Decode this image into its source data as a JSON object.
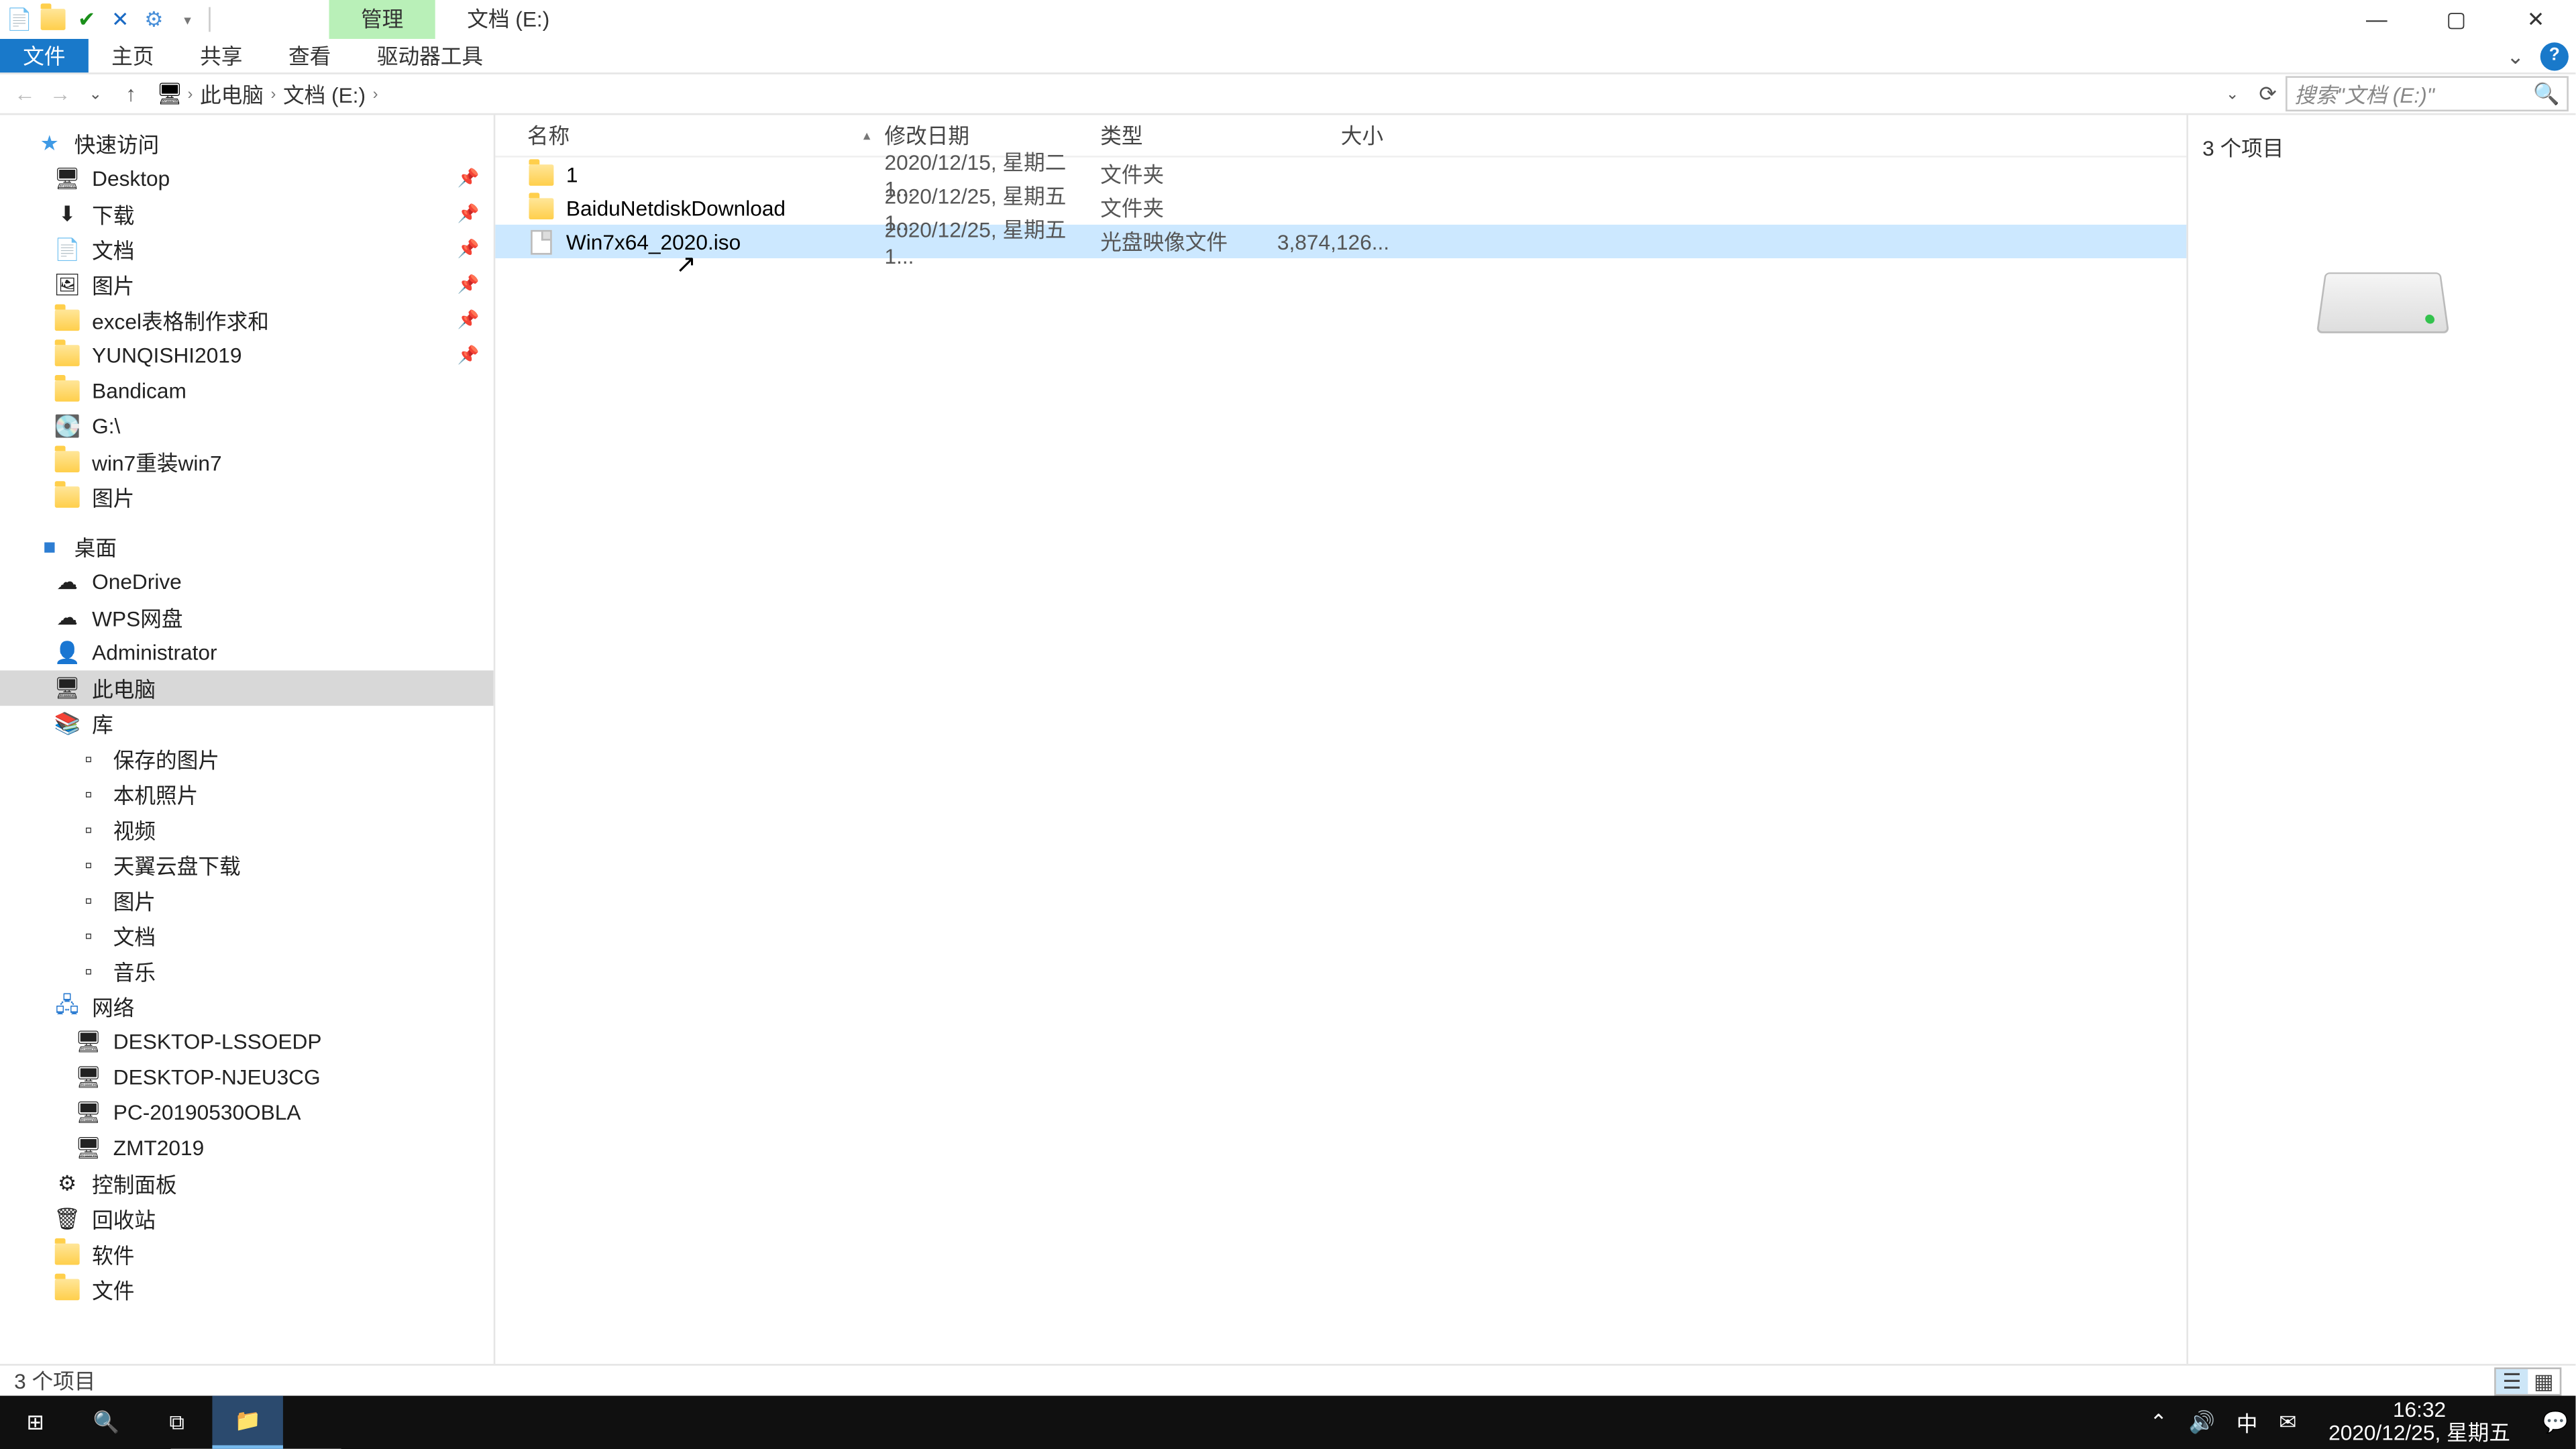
{
  "qat_icons": [
    "props-icon",
    "new-folder-icon",
    "checkbox-icon",
    "delete-x-icon",
    "gear-icon",
    "dropdown-icon"
  ],
  "title_context_tab": "管理",
  "title_location": "文档 (E:)",
  "win": {
    "min": "—",
    "max": "▢",
    "close": "✕"
  },
  "ribbon": {
    "file": "文件",
    "tabs": [
      "主页",
      "共享",
      "查看",
      "驱动器工具"
    ]
  },
  "help": {
    "expand": "⌄",
    "help": "?"
  },
  "nav_back": "←",
  "nav_fwd": "→",
  "nav_recent": "⌄",
  "nav_up": "↑",
  "crumbs": [
    "此电脑",
    "文档 (E:)"
  ],
  "addr_dd": "⌄",
  "addr_refresh": "⟳",
  "search_placeholder": "搜索\"文档 (E:)\"",
  "search_icon": "🔍",
  "sidebar_quick": "快速访问",
  "sidebar_quick_items": [
    {
      "icon": "desktop",
      "label": "Desktop",
      "pin": true
    },
    {
      "icon": "downloads",
      "label": "下载",
      "pin": true
    },
    {
      "icon": "docs",
      "label": "文档",
      "pin": true
    },
    {
      "icon": "pics",
      "label": "图片",
      "pin": true
    },
    {
      "icon": "folder",
      "label": "excel表格制作求和",
      "pin": true
    },
    {
      "icon": "folder",
      "label": "YUNQISHI2019",
      "pin": true
    },
    {
      "icon": "folder",
      "label": "Bandicam",
      "pin": false
    },
    {
      "icon": "drive",
      "label": "G:\\",
      "pin": false
    },
    {
      "icon": "folder",
      "label": "win7重装win7",
      "pin": false
    },
    {
      "icon": "folder",
      "label": "图片",
      "pin": false
    }
  ],
  "sidebar_desktop": "桌面",
  "sidebar_desktop_items": [
    {
      "icon": "onedrive",
      "label": "OneDrive"
    },
    {
      "icon": "wps",
      "label": "WPS网盘"
    },
    {
      "icon": "user",
      "label": "Administrator"
    },
    {
      "icon": "pc",
      "label": "此电脑",
      "sel": true
    },
    {
      "icon": "lib",
      "label": "库"
    }
  ],
  "sidebar_lib_items": [
    {
      "label": "保存的图片"
    },
    {
      "label": "本机照片"
    },
    {
      "label": "视频"
    },
    {
      "label": "天翼云盘下载"
    },
    {
      "label": "图片"
    },
    {
      "label": "文档"
    },
    {
      "label": "音乐"
    }
  ],
  "sidebar_network": "网络",
  "sidebar_net_items": [
    {
      "label": "DESKTOP-LSSOEDP"
    },
    {
      "label": "DESKTOP-NJEU3CG"
    },
    {
      "label": "PC-20190530OBLA"
    },
    {
      "label": "ZMT2019"
    }
  ],
  "sidebar_tail": [
    {
      "icon": "cpanel",
      "label": "控制面板"
    },
    {
      "icon": "recycle",
      "label": "回收站"
    },
    {
      "icon": "folder",
      "label": "软件"
    },
    {
      "icon": "folder",
      "label": "文件"
    }
  ],
  "columns": {
    "name": "名称",
    "date": "修改日期",
    "type": "类型",
    "size": "大小"
  },
  "rows": [
    {
      "icon": "folder",
      "name": "1",
      "date": "2020/12/15, 星期二 1...",
      "type": "文件夹",
      "size": ""
    },
    {
      "icon": "folder",
      "name": "BaiduNetdiskDownload",
      "date": "2020/12/25, 星期五 1...",
      "type": "文件夹",
      "size": ""
    },
    {
      "icon": "iso",
      "name": "Win7x64_2020.iso",
      "date": "2020/12/25, 星期五 1...",
      "type": "光盘映像文件",
      "size": "3,874,126...",
      "sel": true
    }
  ],
  "preview_count": "3 个项目",
  "status_text": "3 个项目",
  "taskbar": {
    "start": "⊞",
    "search": "🔍",
    "taskview": "⧉",
    "explorer": "📁"
  },
  "tray": {
    "up": "⌃",
    "vol": "🔊",
    "ime": "中",
    "mail": "✉",
    "time": "16:32",
    "date": "2020/12/25, 星期五",
    "notif": "💬"
  }
}
